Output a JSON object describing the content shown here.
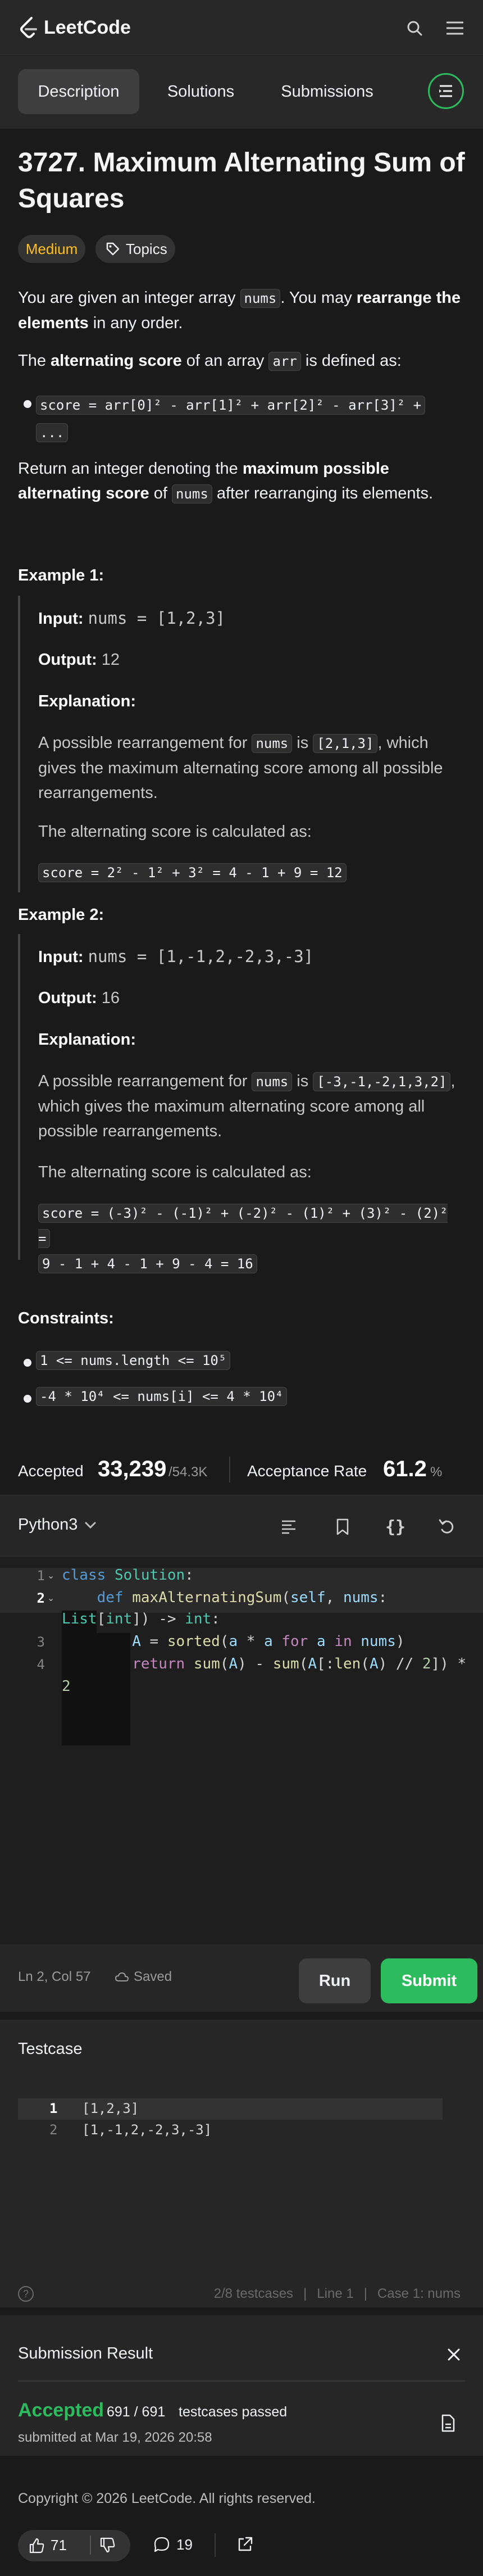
{
  "header": {
    "logo_text": "LeetCode",
    "icons": [
      "search-icon",
      "menu-icon"
    ]
  },
  "tabs": [
    {
      "label": "Description",
      "active": true
    },
    {
      "label": "Solutions",
      "active": false
    },
    {
      "label": "Submissions",
      "active": false
    }
  ],
  "problem": {
    "title_line1": "3727. Maximum Alternating Sum of",
    "title_line2": "Squares",
    "difficulty": "Medium",
    "topics_label": "Topics",
    "intro_1": "You are given an integer array ",
    "intro_code": "nums",
    "intro_2": ". You may ",
    "intro_bold": "rearrange the elements",
    "intro_3": " in any order.",
    "def_1": "The ",
    "def_bold": "alternating score",
    "def_2": " of an array ",
    "def_code": "arr",
    "def_3": " is defined as:",
    "formula_line1": "score = arr[0]² - arr[1]² + arr[2]² - arr[3]² +",
    "formula_line2": "...",
    "ret_1": "Return an integer denoting the ",
    "ret_bold": "maximum possible alternating score",
    "ret_2": " of ",
    "ret_code": "nums",
    "ret_3": " after rearranging its elements."
  },
  "examples": [
    {
      "heading": "Example 1:",
      "input_label": "Input:",
      "input": "nums = [1,2,3]",
      "output_label": "Output:",
      "output": "12",
      "expl_label": "Explanation:",
      "text_1": "A possible rearrangement for ",
      "text_code1": "nums",
      "text_2": " is ",
      "text_code2": "[2,1,3]",
      "text_3": ", which gives the maximum alternating score among all possible rearrangements.",
      "calc_text": "The alternating score is calculated as:",
      "calc": "score = 2² - 1² + 3² = 4 - 1 + 9 = 12"
    },
    {
      "heading": "Example 2:",
      "input_label": "Input:",
      "input": "nums = [1,-1,2,-2,3,-3]",
      "output_label": "Output:",
      "output": "16",
      "expl_label": "Explanation:",
      "text_1": "A possible rearrangement for ",
      "text_code1": "nums",
      "text_2": " is ",
      "text_code2": "[-3,-1,-2,1,3,2]",
      "text_3": ", which gives the maximum alternating score among all possible rearrangements.",
      "calc_text": "The alternating score is calculated as:",
      "calc_line1": "score = (-3)² - (-1)² + (-2)² - (1)² + (3)² - (2)² =",
      "calc_line2": "9 - 1 + 4 - 1 + 9 - 4 = 16"
    }
  ],
  "constraints": {
    "heading": "Constraints:",
    "items": [
      "1 <= nums.length <= 10⁵",
      "-4 * 10⁴ <= nums[i] <= 4 * 10⁴"
    ]
  },
  "stats": {
    "accepted_label": "Accepted",
    "accepted_value": "33,239",
    "accepted_total": "/54.3K",
    "rate_label": "Acceptance Rate",
    "rate_value": "61.2",
    "rate_unit": "%"
  },
  "editor": {
    "language": "Python3",
    "icons": [
      "format-icon",
      "bookmark-icon",
      "braces-icon",
      "undo-icon"
    ],
    "line_numbers": [
      "1",
      "2",
      "3",
      "4"
    ],
    "status_pos": "Ln 2, Col 57",
    "status_saved": "Saved",
    "run_label": "Run",
    "submit_label": "Submit"
  },
  "testcase": {
    "heading": "Testcase",
    "cases": [
      {
        "num": "1",
        "value": "[1,2,3]"
      },
      {
        "num": "2",
        "value": "[1,-1,2,-2,3,-3]"
      }
    ],
    "footer_count": "2/8 testcases",
    "footer_line": "Line 1",
    "footer_case": "Case 1: nums"
  },
  "submission": {
    "heading": "Submission Result",
    "status": "Accepted",
    "passed": "691 / 691",
    "passed_label": "testcases passed",
    "submitted_at": "submitted at Mar 19, 2026 20:58"
  },
  "footer": {
    "copyright": "Copyright © 2026 LeetCode. All rights reserved.",
    "likes": "71",
    "comments": "19"
  },
  "colors": {
    "accent_green": "#2cbb5d",
    "medium": "#ffc01e",
    "bg": "#1a1a1a"
  }
}
